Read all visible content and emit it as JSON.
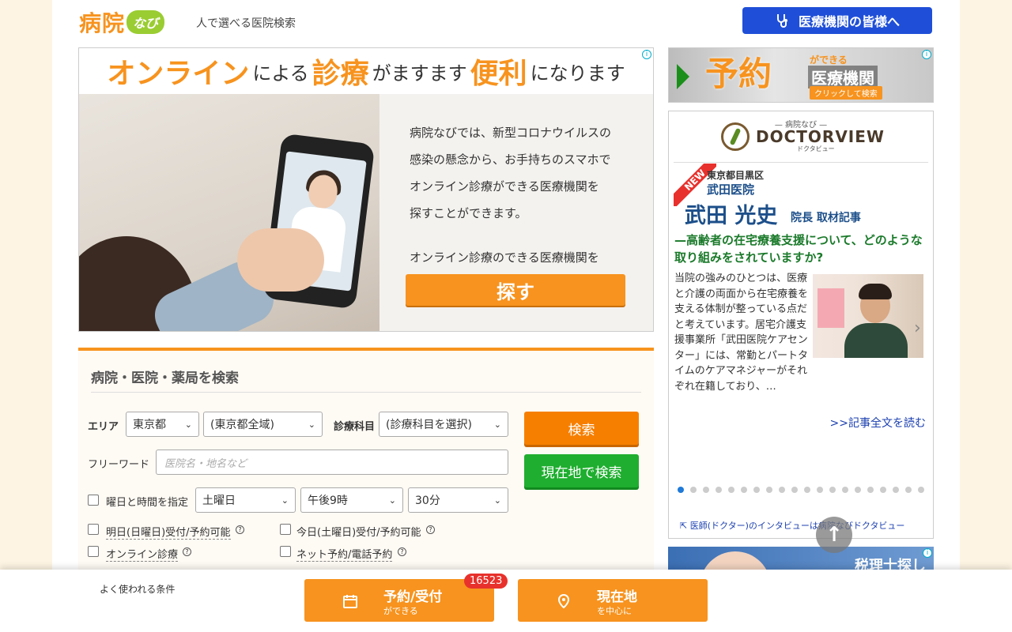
{
  "header": {
    "logo_main": "病院",
    "logo_sub": "なび",
    "tagline": "人で選べる医院検索",
    "medical_button": "医療機関の皆様へ"
  },
  "banner": {
    "headline_1": "オンライン",
    "headline_2": "による",
    "headline_3": "診療",
    "headline_4": "がますます",
    "headline_5": "便利",
    "headline_6": "になります",
    "body_lines": [
      "病院なびでは、新型コロナウイルスの",
      "感染の懸念から、お手持ちのスマホで",
      "オンライン診療ができる医療機関を",
      "探すことができます。"
    ],
    "cta_caption": "オンライン診療のできる医療機関を",
    "cta_button": "探す",
    "ad_marker": "i"
  },
  "search": {
    "title": "病院・医院・薬局を検索",
    "area_label": "エリア",
    "prefecture": "東京都",
    "area": "(東京都全域)",
    "dept_label": "診療科目",
    "dept": "(診療科目を選択)",
    "search_button": "検索",
    "freeword_label": "フリーワード",
    "freeword_placeholder": "医院名・地名など",
    "location_button": "現在地で検索",
    "time_label": "曜日と時間を指定",
    "day": "土曜日",
    "hour": "午後9時",
    "minute": "30分",
    "checks": [
      "明日(日曜日)受付/予約可能",
      "今日(土曜日)受付/予約可能",
      "オンライン診療",
      "ネット予約/電話予約"
    ]
  },
  "side_ad": {
    "big": "予約",
    "small_top": "ができる",
    "mid": "医療機関",
    "cta": "クリックして検索"
  },
  "doctorview": {
    "top_label": "— 病院なび —",
    "brand": "DOCTORVIEW",
    "brand_sub": "ドクタビュー",
    "new_tag": "NEW",
    "area": "東京都目黒区",
    "clinic": "武田医院",
    "doctor_name": "武田 光史",
    "role": "院長 取材記事",
    "question": "—高齢者の在宅療養支援について、どのような取り組みをされていますか?",
    "body": "当院の強みのひとつは、医療と介護の両面から在宅療養を支える体制が整っている点だと考えています。居宅介護支援事業所「武田医院ケアセンター」には、常勤とパートタイムのケアマネジャーがそれぞれ在籍しており、…",
    "read_more": ">>記事全文を読む",
    "footer": "医師(ドクター)のインタビューは病院なびドクタビュー",
    "dots_total": 20,
    "dots_active": 1
  },
  "bottom_ad": {
    "text": "税理士探し"
  },
  "bottom_bar": {
    "label": "よく使われる条件",
    "reserve_main": "予約/受付",
    "reserve_sub": "ができる",
    "reserve_count": "16523",
    "location_main": "現在地",
    "location_sub": "を中心に"
  },
  "colors": {
    "brand_orange": "#f7931e",
    "brand_blue": "#1f4fd8",
    "search_green": "#1fae2f"
  }
}
